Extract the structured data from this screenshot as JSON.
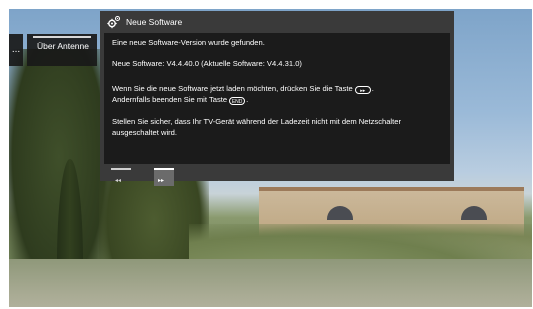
{
  "menu": {
    "ellipsis": "...",
    "current_item": "Über Antenne"
  },
  "dialog": {
    "icon": "gear-icon",
    "title": "Neue Software",
    "line1": "Eine neue Software-Version wurde gefunden.",
    "line2": "Neue Software:  V4.4.40.0   (Aktuelle Software:  V4.4.31.0)",
    "line3a": "Wenn Sie die neue Software jetzt laden möchten, drücken Sie die Taste",
    "line3b": "Andernfalls beenden Sie mit Taste",
    "line4": "Stellen Sie sicher, dass Ihr TV-Gerät während der Ladezeit nicht mit dem Netzschalter ausgeschaltet wird."
  },
  "buttons": {
    "prev": "◂◂",
    "next": "▸▸"
  }
}
